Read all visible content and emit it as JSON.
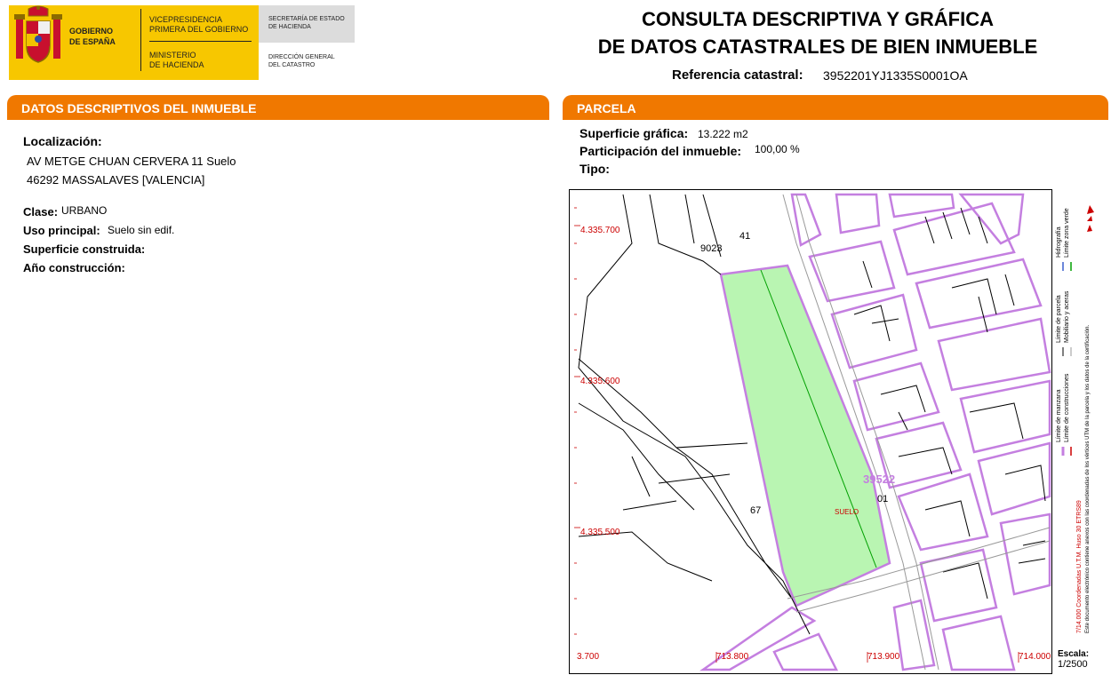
{
  "header": {
    "gobierno": [
      "GOBIERNO",
      "DE ESPAÑA"
    ],
    "vicepresidencia": [
      "VICEPRESIDENCIA",
      "PRIMERA DEL GOBIERNO"
    ],
    "ministerio": [
      "MINISTERIO",
      "DE HACIENDA"
    ],
    "secretaria": [
      "SECRETARÍA DE ESTADO",
      "DE HACIENDA"
    ],
    "direccion": [
      "DIRECCIÓN GENERAL",
      "DEL CATASTRO"
    ],
    "title_line1": "CONSULTA DESCRIPTIVA Y GRÁFICA",
    "title_line2": "DE DATOS CATASTRALES DE BIEN INMUEBLE",
    "ref_label": "Referencia catastral:",
    "ref_value": "3952201YJ1335S0001OA",
    "brand_color": "#f7c700"
  },
  "left": {
    "banner_prefix": "DATOS DESCRIPTIVOS DEL ",
    "banner_emph": "INMUEBLE",
    "banner_color": "#f07800",
    "localizacion_label": "Localización:",
    "address1": "AV METGE CHUAN CERVERA 11 Suelo",
    "address2": "46292 MASSALAVES [VALENCIA]",
    "clase_label": "Clase:",
    "clase_value": "URBANO",
    "uso_label": "Uso principal:",
    "uso_value": "Suelo sin edif.",
    "superficie_label": "Superficie construida:",
    "anio_label": "Año construcción:"
  },
  "right": {
    "banner": "PARCELA",
    "sup_label": "Superficie gráfica:",
    "sup_value": "13.222 m2",
    "part_label": "Participación del inmueble:",
    "part_value": "100,00 %",
    "tipo_label": "Tipo:"
  },
  "map": {
    "y_labels": [
      "4.335.700",
      "4.335.600",
      "4.335.500"
    ],
    "x_labels": [
      "3.700",
      "713.800",
      "713.900",
      "714.000"
    ],
    "parcel_labels": [
      "9023",
      "41",
      "67",
      "39522",
      "01"
    ],
    "suelo_label": "SUELO",
    "parcel_fill": "#b9f5b2",
    "block_color": "#c47fe0",
    "grid_color": "#cc0000",
    "scale_label": "Escala:",
    "scale_value": "1/2500",
    "legend": [
      "Límite de manzana",
      "Límite de construcciones",
      "Límite de parcela",
      "Mobiliario y aceras",
      "Hidrografía",
      "Límite zona verde"
    ],
    "legend_note1": "7/14.000 Coordenadas U.T.M. Huso 30 ETRS89",
    "legend_note2": "Este documento electrónico contiene anexos con las coordenadas de los vértices UTM de la parcela y los datos de la certificación."
  }
}
